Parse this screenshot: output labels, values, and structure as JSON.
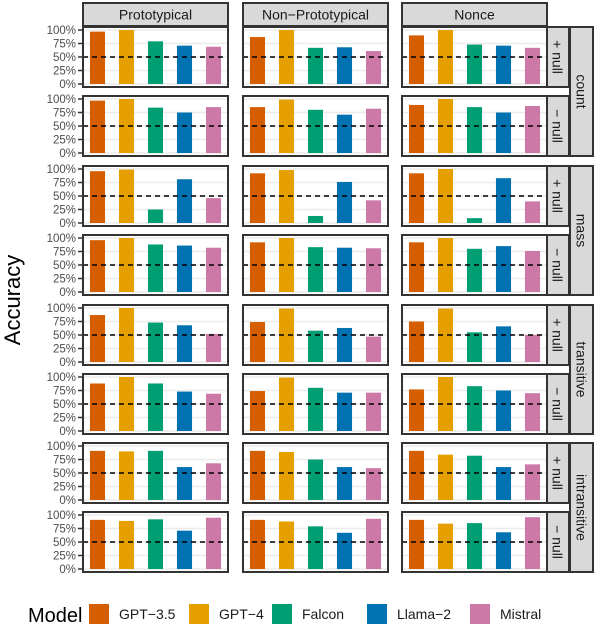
{
  "chart_data": {
    "type": "bar",
    "ylabel": "Accuracy",
    "xlabel": "",
    "ylim": [
      0,
      1
    ],
    "y_ticks": [
      "0%",
      "25%",
      "50%",
      "75%",
      "100%"
    ],
    "y_tick_values": [
      0,
      0.25,
      0.5,
      0.75,
      1.0
    ],
    "reference_line": {
      "value": 0.5,
      "style": "dashed",
      "color": "#000000"
    },
    "grid": true,
    "facet_columns": [
      "Prototypical",
      "Non−Prototypical",
      "Nonce"
    ],
    "facet_row_groups": [
      "count",
      "mass",
      "transitive",
      "intransitive"
    ],
    "facet_row_sub": [
      "+ null",
      "− null"
    ],
    "categories": [
      "GPT−3.5",
      "GPT−4",
      "Falcon",
      "Llama−2",
      "Mistral"
    ],
    "colors": {
      "GPT−3.5": "#D55E00",
      "GPT−4": "#E69F00",
      "Falcon": "#009E73",
      "Llama−2": "#0072B2",
      "Mistral": "#CC79A7"
    },
    "legend": {
      "title": "Model",
      "placement": "bottom",
      "entries": [
        "GPT−3.5",
        "GPT−4",
        "Falcon",
        "Llama−2",
        "Mistral"
      ]
    },
    "panels": [
      {
        "group": "count",
        "sub": "+ null",
        "values": [
          [
            0.97,
            1.0,
            0.79,
            0.71,
            0.69
          ],
          [
            0.87,
            1.0,
            0.67,
            0.68,
            0.61
          ],
          [
            0.9,
            1.0,
            0.73,
            0.71,
            0.67
          ]
        ]
      },
      {
        "group": "count",
        "sub": "− null",
        "values": [
          [
            0.97,
            1.0,
            0.84,
            0.75,
            0.85
          ],
          [
            0.85,
            0.99,
            0.8,
            0.71,
            0.82
          ],
          [
            0.89,
            1.0,
            0.85,
            0.75,
            0.87
          ]
        ]
      },
      {
        "group": "mass",
        "sub": "+ null",
        "values": [
          [
            0.96,
            0.99,
            0.25,
            0.81,
            0.46
          ],
          [
            0.92,
            0.98,
            0.13,
            0.76,
            0.42
          ],
          [
            0.92,
            1.0,
            0.09,
            0.83,
            0.4
          ]
        ]
      },
      {
        "group": "mass",
        "sub": "− null",
        "values": [
          [
            0.96,
            1.0,
            0.88,
            0.86,
            0.82
          ],
          [
            0.92,
            1.0,
            0.83,
            0.82,
            0.81
          ],
          [
            0.92,
            1.0,
            0.8,
            0.85,
            0.76
          ]
        ]
      },
      {
        "group": "transitive",
        "sub": "+ null",
        "values": [
          [
            0.87,
            1.0,
            0.73,
            0.68,
            0.52
          ],
          [
            0.74,
            0.99,
            0.58,
            0.63,
            0.47
          ],
          [
            0.75,
            0.99,
            0.55,
            0.66,
            0.5
          ]
        ]
      },
      {
        "group": "transitive",
        "sub": "− null",
        "values": [
          [
            0.88,
            1.0,
            0.88,
            0.73,
            0.69
          ],
          [
            0.74,
            0.99,
            0.8,
            0.71,
            0.71
          ],
          [
            0.77,
            1.0,
            0.83,
            0.75,
            0.7
          ]
        ]
      },
      {
        "group": "intransitive",
        "sub": "+ null",
        "values": [
          [
            0.91,
            0.9,
            0.91,
            0.61,
            0.68
          ],
          [
            0.91,
            0.89,
            0.75,
            0.61,
            0.59
          ],
          [
            0.91,
            0.84,
            0.82,
            0.61,
            0.66
          ]
        ]
      },
      {
        "group": "intransitive",
        "sub": "− null",
        "values": [
          [
            0.91,
            0.89,
            0.92,
            0.71,
            0.95
          ],
          [
            0.91,
            0.88,
            0.79,
            0.67,
            0.93
          ],
          [
            0.91,
            0.84,
            0.85,
            0.68,
            0.96
          ]
        ]
      }
    ]
  }
}
